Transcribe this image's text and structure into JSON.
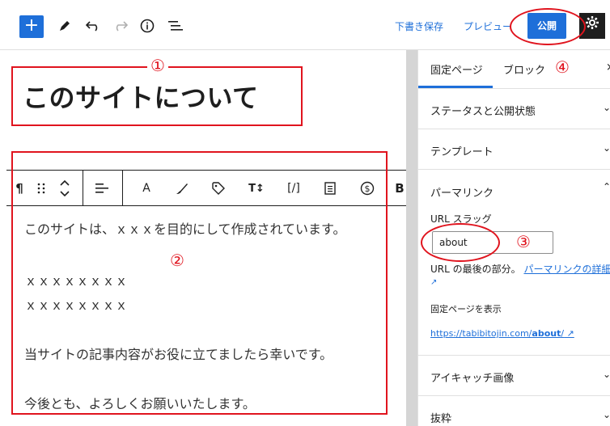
{
  "toolbar": {
    "add_label": "+",
    "save_draft_label": "下書き保存",
    "preview_label": "プレビュー",
    "publish_label": "公開"
  },
  "editor": {
    "title": "このサイトについて",
    "paragraphs": [
      "このサイトは、ｘｘｘを目的にして作成されています。",
      "ｘｘｘｘｘｘｘｘ",
      "ｘｘｘｘｘｘｘｘ",
      "当サイトの記事内容がお役に立てましたら幸いです。",
      "今後とも、よろしくお願いいたします。"
    ],
    "block_toolbar": {
      "paragraph_icon": "¶",
      "text_color_label": "A",
      "bold_label": "B",
      "shortcode_label": "[/]"
    }
  },
  "sidebar": {
    "tab_page": "固定ページ",
    "tab_block": "ブロック",
    "status_panel": "ステータスと公開状態",
    "template_panel": "テンプレート",
    "permalink_panel": "パーマリンク",
    "url_slug_label": "URL スラッグ",
    "url_slug_value": "about",
    "slug_help_text": "URL の最後の部分。",
    "slug_help_link": "パーマリンクの詳細",
    "view_page_label": "固定ページを表示",
    "page_url_prefix": "https://tabibitojin.com/",
    "page_url_slug": "about",
    "page_url_suffix": "/",
    "featured_image_panel": "アイキャッチ画像",
    "excerpt_panel": "抜粋"
  },
  "annotations": {
    "n1": "①",
    "n2": "②",
    "n3": "③",
    "n4": "④"
  },
  "colors": {
    "accent": "#1e6fd9",
    "annotation": "#e0141e"
  }
}
